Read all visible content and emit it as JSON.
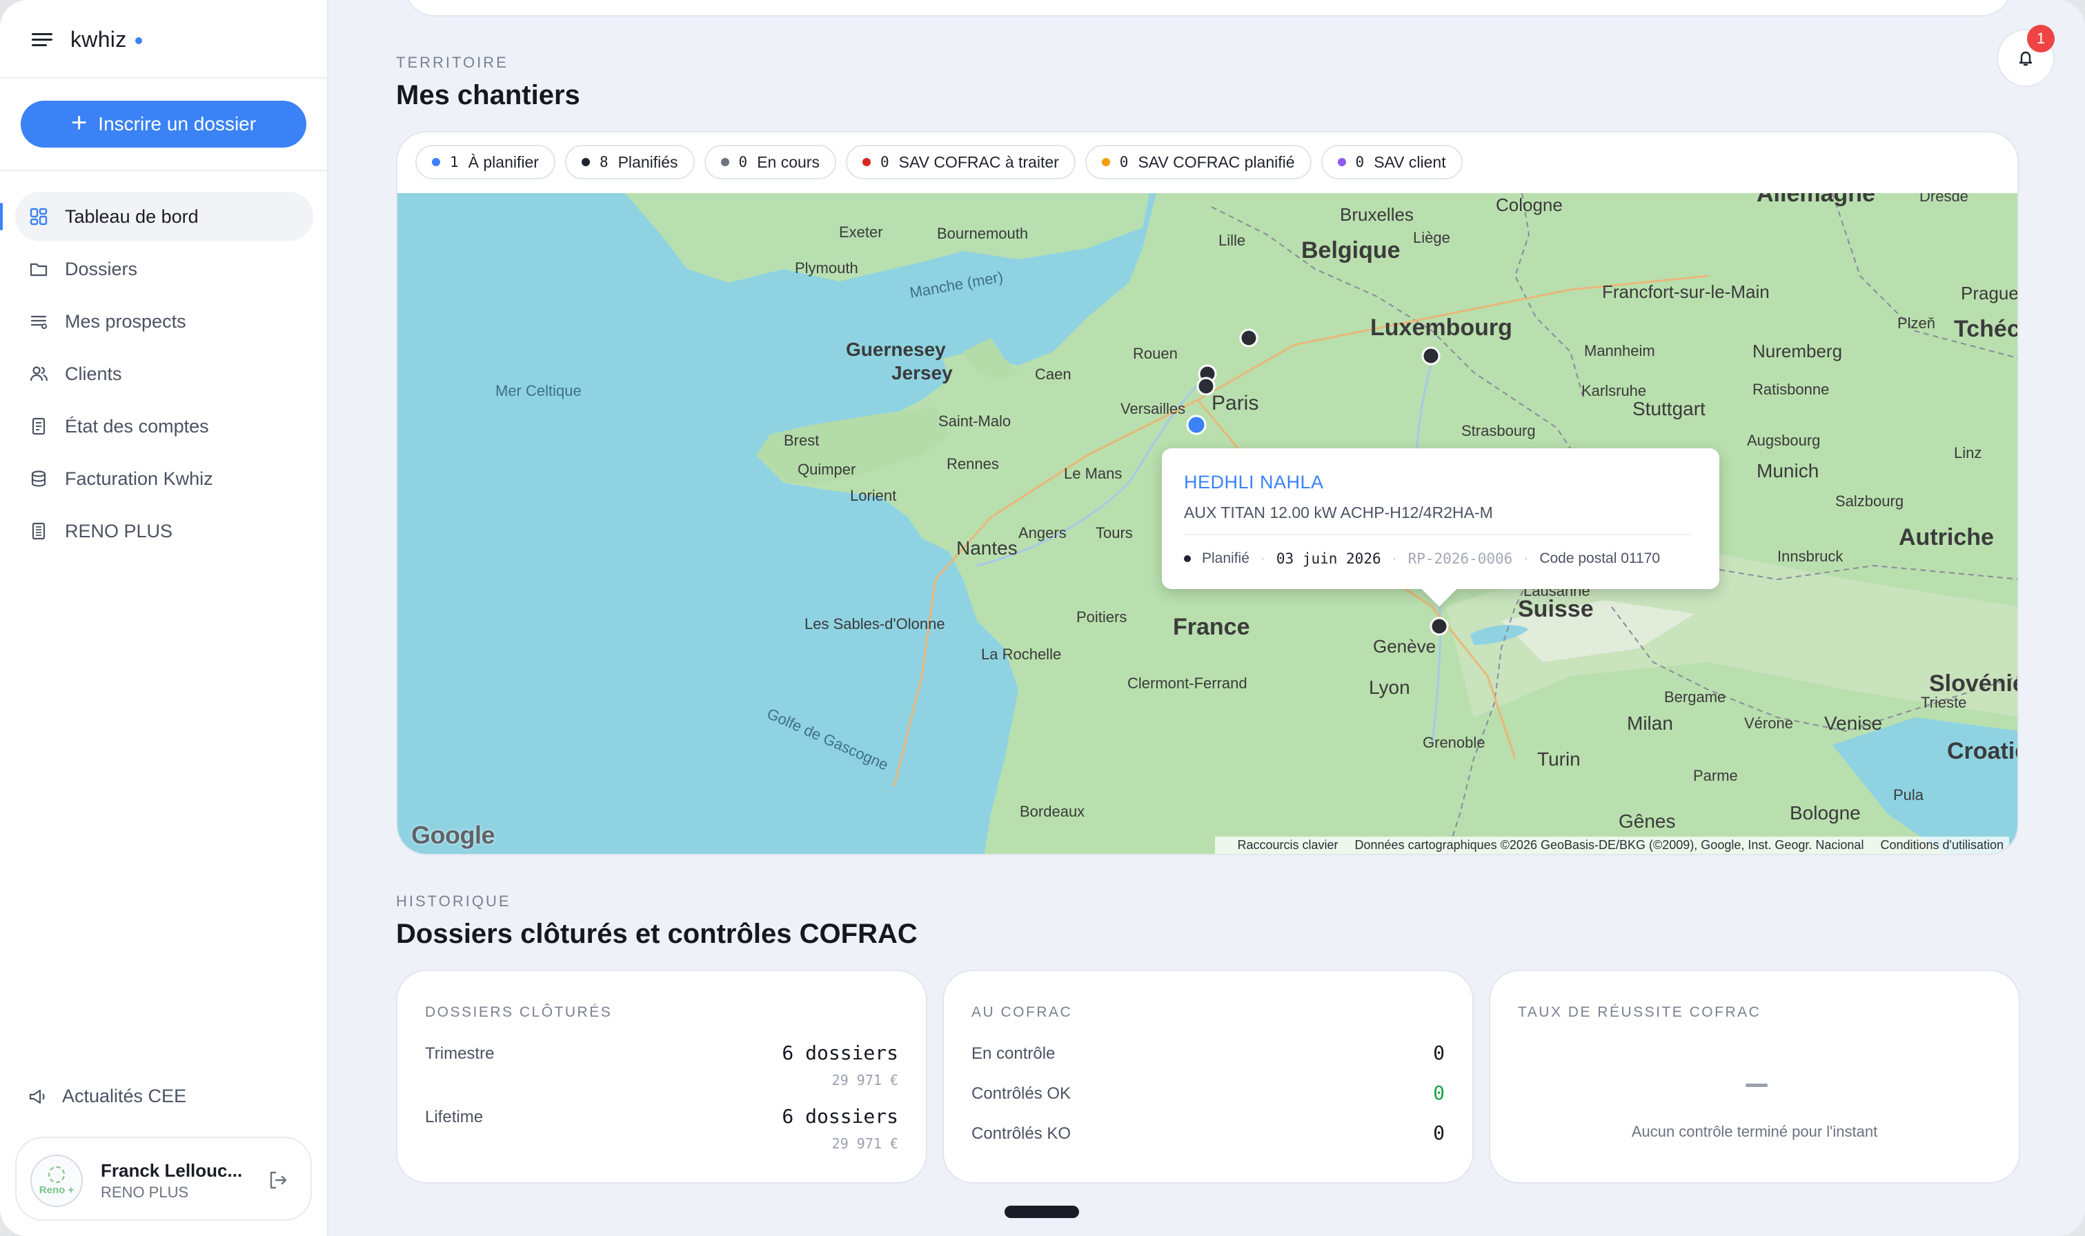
{
  "app": {
    "brand": "kwhiz"
  },
  "sidebar": {
    "new_button_label": "Inscrire un dossier",
    "items": [
      {
        "label": "Tableau de bord",
        "icon": "dashboard-icon",
        "active": true
      },
      {
        "label": "Dossiers",
        "icon": "folder-icon"
      },
      {
        "label": "Mes prospects",
        "icon": "list-icon"
      },
      {
        "label": "Clients",
        "icon": "users-icon"
      },
      {
        "label": "État des comptes",
        "icon": "receipt-icon"
      },
      {
        "label": "Facturation Kwhiz",
        "icon": "database-icon"
      },
      {
        "label": "RENO PLUS",
        "icon": "document-icon"
      }
    ],
    "news_label": "Actualités CEE",
    "user": {
      "name": "Franck Lellouc...",
      "org": "RENO PLUS",
      "avatar_text": "Reno +"
    }
  },
  "notifications": {
    "count": "1"
  },
  "territory": {
    "eyebrow": "TERRITOIRE",
    "title": "Mes chantiers",
    "filters": [
      {
        "count": "1",
        "label": "À planifier",
        "color": "#3b82f6"
      },
      {
        "count": "8",
        "label": "Planifiés",
        "color": "#1f2430"
      },
      {
        "count": "0",
        "label": "En cours",
        "color": "#6b7280"
      },
      {
        "count": "0",
        "label": "SAV COFRAC à traiter",
        "color": "#dc2626"
      },
      {
        "count": "0",
        "label": "SAV COFRAC planifié",
        "color": "#f59e0b"
      },
      {
        "count": "0",
        "label": "SAV client",
        "color": "#8b5cf6"
      }
    ],
    "popup": {
      "name": "HEDHLI NAHLA",
      "product": "AUX TITAN 12.00 kW ACHP-H12/4R2HA-M",
      "status": "Planifié",
      "date": "03 juin 2026",
      "reference": "RP-2026-0006",
      "postal": "Code postal 01170"
    },
    "map": {
      "labels": {
        "countries": [
          "Belgique",
          "Luxembourg",
          "France",
          "Suisse",
          "Autriche",
          "Slovénie",
          "Croatie",
          "Allemagne",
          "Tchéc"
        ],
        "islands": [
          "Guernesey",
          "Jersey"
        ],
        "seas": [
          "Mer Celtique",
          "Manche (mer)",
          "Golfe de Gascogne"
        ],
        "cities": [
          "Exeter",
          "Bournemouth",
          "Plymouth",
          "Bruxelles",
          "Cologne",
          "Lille",
          "Liège",
          "Francfort-sur-le-Main",
          "Prague",
          "Plzeň",
          "Mannheim",
          "Nuremberg",
          "Rouen",
          "Caen",
          "Karlsruhe",
          "Ratisbonne",
          "Stuttgart",
          "Versailles",
          "Paris",
          "Saint-Malo",
          "Strasbourg",
          "Augsbourg",
          "Brest",
          "Rennes",
          "Le Mans",
          "Munich",
          "Linz",
          "Quimper",
          "Lorient",
          "Salzbourg",
          "Angers",
          "Tours",
          "Nantes",
          "Innsbruck",
          "Lausanne",
          "Les Sables-d'Olonne",
          "Poitiers",
          "Genève",
          "La Rochelle",
          "Clermont-Ferrand",
          "Lyon",
          "Bergame",
          "Trieste",
          "Milan",
          "Vérone",
          "Venise",
          "Grenoble",
          "Turin",
          "Parme",
          "Bordeaux",
          "Pula",
          "Gênes",
          "Bologne",
          "Dresde"
        ]
      },
      "logo": "Google",
      "footer": [
        "Raccourcis clavier",
        "Données cartographiques ©2026 GeoBasis-DE/BKG (©2009), Google, Inst. Geogr. Nacional",
        "Conditions d'utilisation"
      ]
    }
  },
  "history": {
    "eyebrow": "HISTORIQUE",
    "title": "Dossiers clôturés et contrôles COFRAC",
    "closed": {
      "title": "DOSSIERS CLÔTURÉS",
      "rows": [
        {
          "label": "Trimestre",
          "value": "6 dossiers",
          "sub": "29 971 €"
        },
        {
          "label": "Lifetime",
          "value": "6 dossiers",
          "sub": "29 971 €"
        }
      ]
    },
    "cofrac": {
      "title": "AU COFRAC",
      "rows": [
        {
          "label": "En contrôle",
          "value": "0"
        },
        {
          "label": "Contrôlés OK",
          "value": "0",
          "color": "#16a34a"
        },
        {
          "label": "Contrôlés KO",
          "value": "0"
        }
      ]
    },
    "success": {
      "title": "TAUX DE RÉUSSITE COFRAC",
      "empty": "Aucun contrôle terminé pour l'instant"
    }
  }
}
